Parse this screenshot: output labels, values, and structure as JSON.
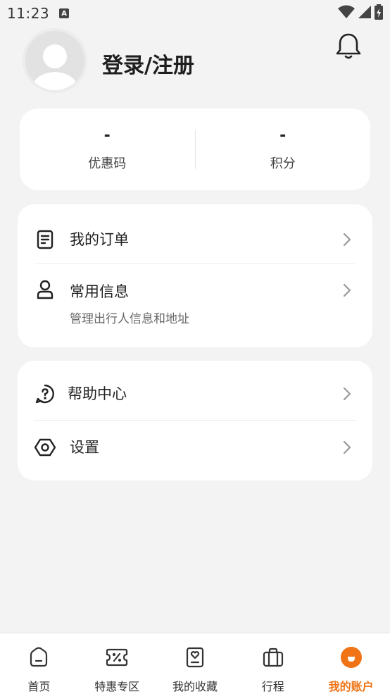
{
  "status_bar": {
    "time": "11:23",
    "indicator": "A"
  },
  "header": {
    "login_label": "登录/注册"
  },
  "stats": [
    {
      "value": "-",
      "label": "优惠码"
    },
    {
      "value": "-",
      "label": "积分"
    }
  ],
  "menu_group_1": [
    {
      "label": "我的订单",
      "icon": "order-icon"
    },
    {
      "label": "常用信息",
      "sub": "管理出行人信息和地址",
      "icon": "user-icon"
    }
  ],
  "menu_group_2": [
    {
      "label": "帮助中心",
      "icon": "help-icon"
    },
    {
      "label": "设置",
      "icon": "settings-icon"
    }
  ],
  "bottom_nav": [
    {
      "label": "首页",
      "icon": "home-icon",
      "active": false
    },
    {
      "label": "特惠专区",
      "icon": "coupon-icon",
      "active": false
    },
    {
      "label": "我的收藏",
      "icon": "favorites-icon",
      "active": false
    },
    {
      "label": "行程",
      "icon": "suitcase-icon",
      "active": false
    },
    {
      "label": "我的账户",
      "icon": "account-icon",
      "active": true
    }
  ],
  "colors": {
    "accent": "#f07315",
    "background": "#f3f3f3",
    "card": "#ffffff"
  }
}
